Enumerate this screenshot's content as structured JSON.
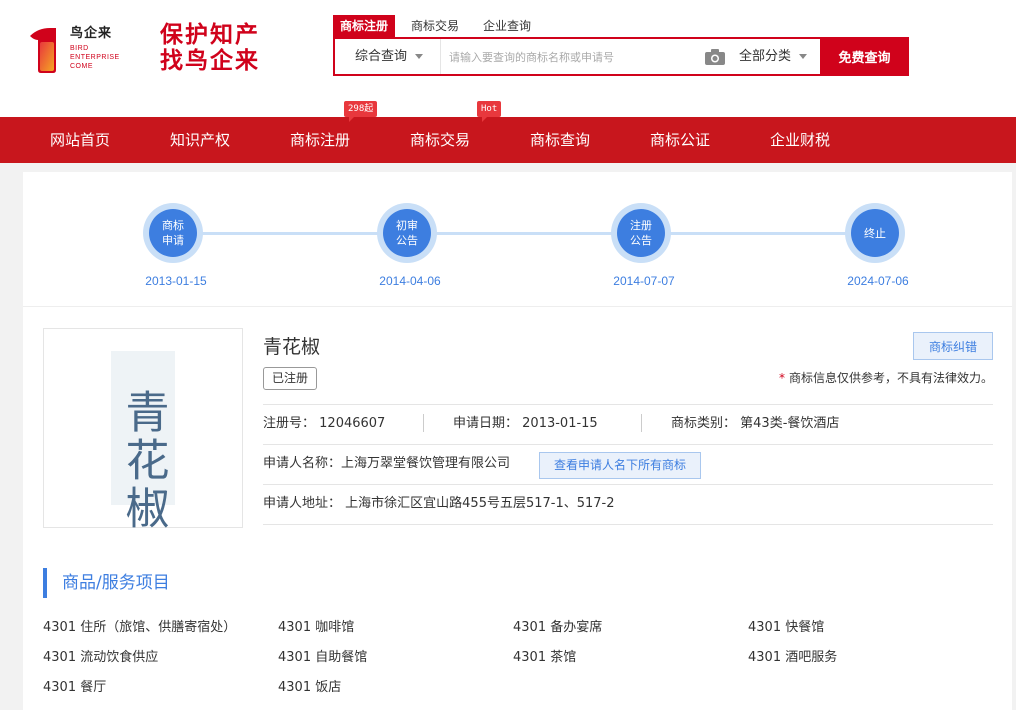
{
  "brand": {
    "logo_cn": "鸟企来",
    "logo_en": [
      "BIRD",
      "ENTERPRISE",
      "COME"
    ],
    "slogan_line1": "保护知产",
    "slogan_line2": "找鸟企来",
    "accent_color": "#d0021b"
  },
  "search": {
    "tabs": [
      "商标注册",
      "商标交易",
      "企业查询"
    ],
    "active_tab": "商标注册",
    "type_label": "综合查询",
    "placeholder": "请输入要查询的商标名称或申请号",
    "category_label": "全部分类",
    "button_label": "免费查询"
  },
  "nav": {
    "items": [
      "网站首页",
      "知识产权",
      "商标注册",
      "商标交易",
      "商标查询",
      "商标公证",
      "企业财税"
    ],
    "badges": {
      "register": "298起",
      "trade": "Hot"
    }
  },
  "timeline": {
    "steps": [
      {
        "label": "商标申请",
        "date": "2013-01-15"
      },
      {
        "label": "初审公告",
        "date": "2014-04-06"
      },
      {
        "label": "注册公告",
        "date": "2014-07-07"
      },
      {
        "label": "终止",
        "date": "2024-07-06"
      }
    ]
  },
  "trademark": {
    "image_text": "青花椒",
    "name": "青花椒",
    "status": "已注册",
    "correct_button": "商标纠错",
    "disclaimer": "商标信息仅供参考，不具有法律效力。",
    "reg_no_label": "注册号：",
    "reg_no": "12046607",
    "apply_date_label": "申请日期：",
    "apply_date": "2013-01-15",
    "class_label": "商标类别：",
    "class_value": "第43类-餐饮酒店",
    "applicant_label": "申请人名称：",
    "applicant": "上海万翠堂餐饮管理有限公司",
    "applicant_button": "查看申请人名下所有商标",
    "address_label": "申请人地址：",
    "address": "上海市徐汇区宜山路455号五层517-1、517-2"
  },
  "goods": {
    "title": "商品/服务项目",
    "items": [
      "4301 住所（旅馆、供膳寄宿处）",
      "4301 咖啡馆",
      "4301 备办宴席",
      "4301 快餐馆",
      "4301 流动饮食供应",
      "4301 自助餐馆",
      "4301 茶馆",
      "4301 酒吧服务",
      "4301 餐厅",
      "4301 饭店"
    ]
  }
}
